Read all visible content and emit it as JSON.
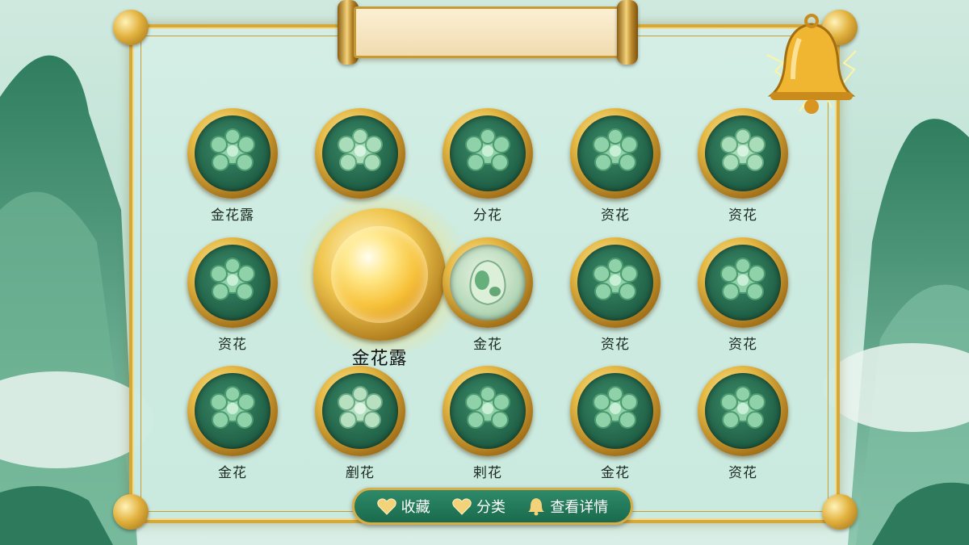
{
  "header": {
    "title": ""
  },
  "grid": {
    "row1": [
      "金花露",
      "",
      "分花",
      "资花",
      "资花"
    ],
    "row2": [
      "资花",
      "",
      "金花",
      "资花",
      "资花"
    ],
    "row3": [
      "金花",
      "剷花",
      "剌花",
      "金花",
      "资花"
    ]
  },
  "featured": {
    "label": "金花露",
    "icon": "golden-orb"
  },
  "special_item": {
    "icon": "jade-pendant"
  },
  "toolbar": {
    "favorite_label": "收藏",
    "category_label": "分类",
    "details_label": "查看详情"
  },
  "icons": {
    "bell": "bell-icon",
    "favorite": "heart-icon",
    "category": "heart-icon",
    "details": "bell-icon",
    "medal": "jade-flower-icon"
  },
  "colors": {
    "gold": "#d4a93c",
    "jade_dark": "#1f5f45",
    "jade_light": "#8fd1a8",
    "bar_green": "#1a6a4d"
  }
}
